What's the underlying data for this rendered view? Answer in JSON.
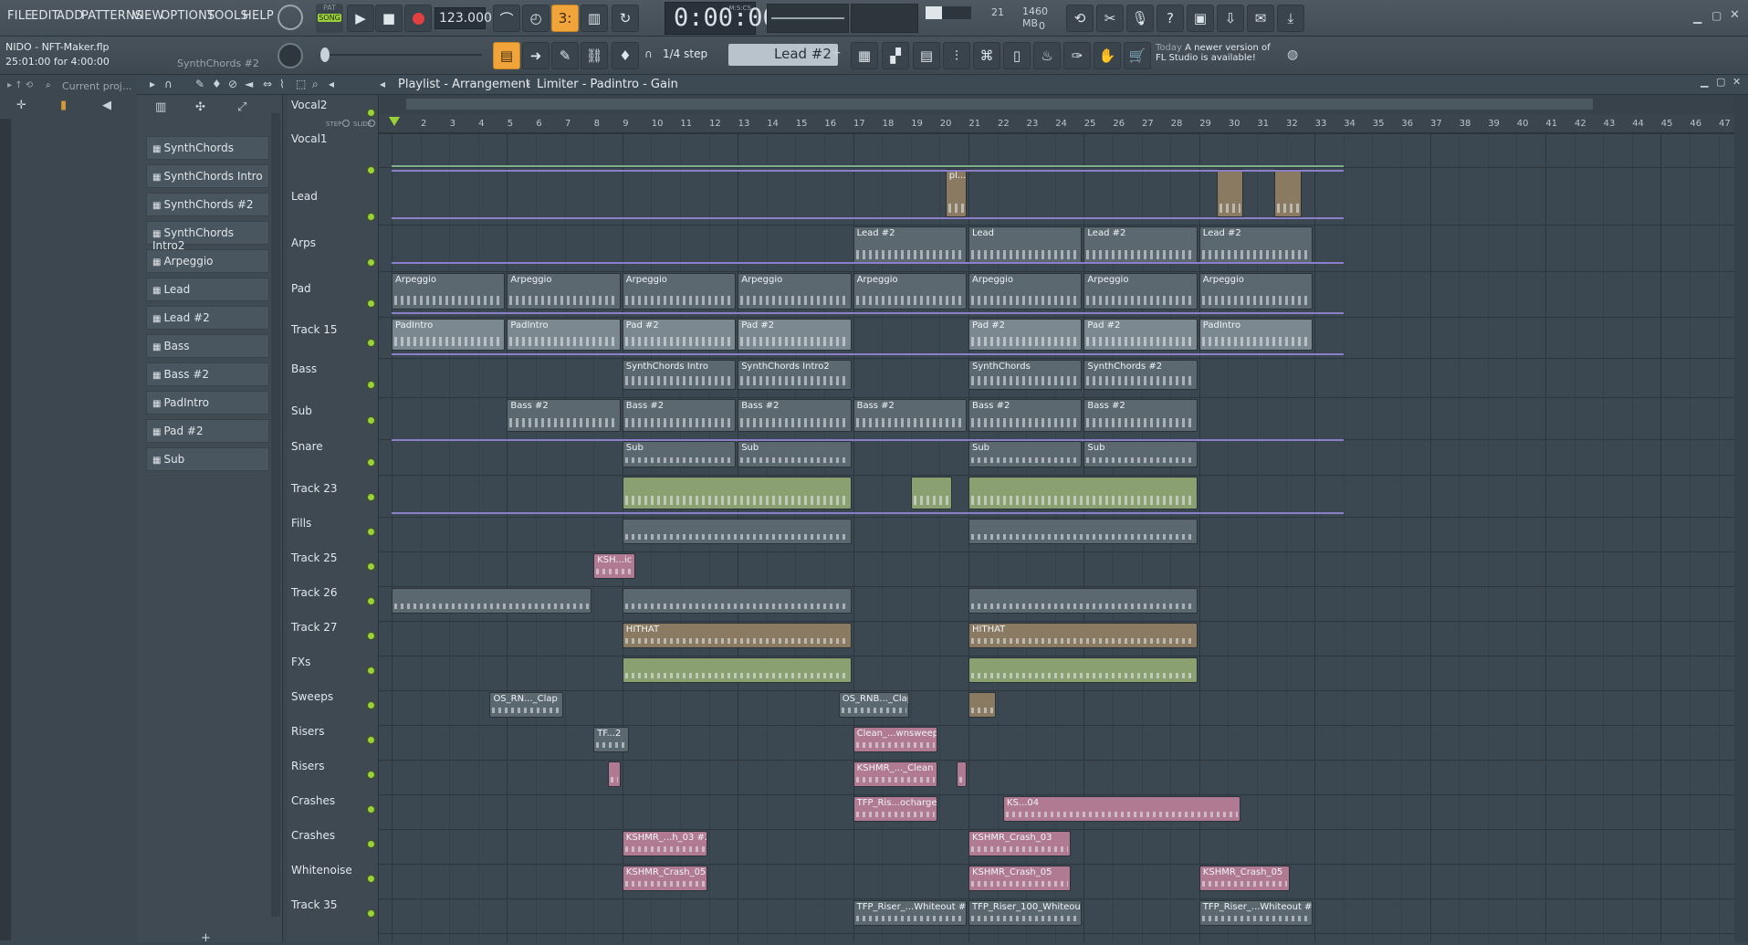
{
  "menu": [
    "FILE",
    "EDIT",
    "ADD",
    "PATTERNS",
    "VIEW",
    "OPTIONS",
    "TOOLS",
    "HELP"
  ],
  "transport": {
    "pat_label": "PAT",
    "song_label": "SONG",
    "tempo": "123.000",
    "time": "0:00:00",
    "time_unit": "M:S:CS",
    "memory": "1460 MB",
    "cpu": "21",
    "voices": "0"
  },
  "project": {
    "filename": "NIDO - NFT-Maker.flp",
    "position": "25:01:00 for 4:00:00",
    "pattern": "SynthChords #2"
  },
  "snap": {
    "step": "1/4 step",
    "pattern_selector": "Lead #2"
  },
  "news": {
    "label": "Today",
    "text": "A newer version of FL Studio is available!"
  },
  "browser": {
    "label": "Current proj..."
  },
  "breadcrumb": {
    "playlist": "Playlist - Arrangement",
    "limiter": "Limiter - Padintro - Gain"
  },
  "slide_labels": {
    "step": "STEP",
    "slide": "SLIDE"
  },
  "patterns": [
    "SynthChords",
    "SynthChords Intro",
    "SynthChords #2",
    "SynthChords Intro2",
    "Arpeggio",
    "Lead",
    "Lead #2",
    "Bass",
    "Bass #2",
    "PadIntro",
    "Pad #2",
    "Sub"
  ],
  "ruler": [
    "2",
    "3",
    "4",
    "5",
    "6",
    "7",
    "8",
    "9",
    "10",
    "11",
    "12",
    "13",
    "14",
    "15",
    "16",
    "17",
    "18",
    "19",
    "20",
    "21",
    "22",
    "23",
    "24",
    "25",
    "26",
    "27",
    "28",
    "29",
    "30",
    "31",
    "32",
    "33",
    "34",
    "35",
    "36",
    "37",
    "38",
    "39",
    "40",
    "41",
    "42",
    "43",
    "44",
    "45",
    "46",
    "47"
  ],
  "tracks": [
    "Vocal2",
    "Vocal1",
    "Lead",
    "Arps",
    "Pad",
    "Track 15",
    "Bass",
    "Sub",
    "Snare",
    "Track 23",
    "Fills",
    "Track 25",
    "Track 26",
    "Track 27",
    "FXs",
    "Sweeps",
    "Risers",
    "Risers",
    "Crashes",
    "Crashes",
    "Whitenoise",
    "Track 35"
  ],
  "clips": {
    "vocal1": [
      "pl...ne"
    ],
    "lead": [
      "Lead #2",
      "Lead",
      "Lead #2",
      "Lead #2"
    ],
    "arps": [
      "Arpeggio",
      "Arpeggio",
      "Arpeggio",
      "Arpeggio",
      "Arpeggio",
      "Arpeggio",
      "Arpeggio",
      "Arpeggio"
    ],
    "pad": [
      "PadIntro",
      "PadIntro",
      "Pad #2",
      "Pad #2",
      "Pad #2",
      "Pad #2",
      "PadIntro"
    ],
    "track15": [
      "SynthChords Intro",
      "SynthChords Intro2",
      "SynthChords",
      "SynthChords #2"
    ],
    "bass": [
      "Bass #2",
      "Bass #2",
      "Bass #2",
      "Bass #2",
      "Bass #2",
      "Bass #2"
    ],
    "sub": [
      "Sub",
      "Sub",
      "Sub",
      "Sub"
    ],
    "fills": [
      "KSH...ic"
    ],
    "track26": [
      "HITHAT",
      "HITHAT"
    ],
    "fxs": [
      "OS_RN..._Clap",
      "OS_RNB..._Clap"
    ],
    "sweeps": [
      "TF...2",
      "Clean_...wnsweep"
    ],
    "risers1": [
      "KSHMR_..._Clean"
    ],
    "risers2": [
      "TFP_Ris...ocharge",
      "KS...04"
    ],
    "crashes1": [
      "KSHMR_...h_03 #2",
      "KSHMR_Crash_03"
    ],
    "crashes2": [
      "KSHMR_Crash_05",
      "KSHMR_Crash_05",
      "KSHMR_Crash_05"
    ],
    "whitenoise": [
      "TFP_Riser_...Whiteout #2",
      "TFP_Riser_100_Whiteout",
      "TFP_Riser_...Whiteout #2"
    ]
  },
  "colors": {
    "accent_orange": "#f0a43a",
    "clip_grey": "#5c6870",
    "clip_light": "#7b8890",
    "clip_tan": "#8a7a62",
    "clip_pink": "#b07a93",
    "clip_green": "#8aa070",
    "led_green": "#9ad13a"
  }
}
